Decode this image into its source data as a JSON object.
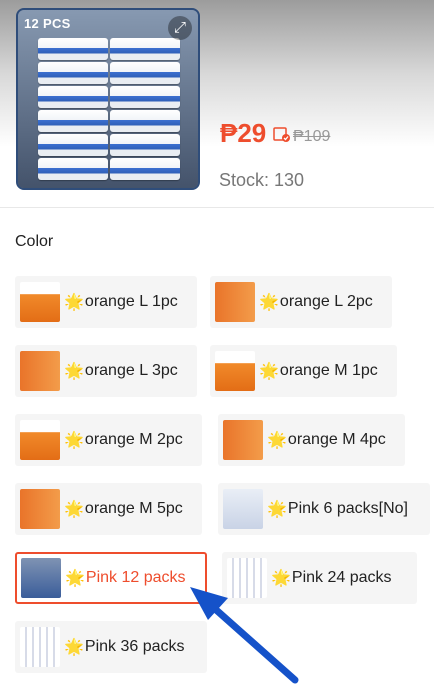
{
  "product": {
    "pcs_tag": "12 PCS",
    "price": "₱29",
    "original_price": "₱109",
    "stock_label": "Stock: 130"
  },
  "variations": {
    "label": "Color",
    "options": [
      {
        "label": "orange L 1pc",
        "selected": false
      },
      {
        "label": "orange L 2pc",
        "selected": false
      },
      {
        "label": "orange L 3pc",
        "selected": false
      },
      {
        "label": "orange M 1pc",
        "selected": false
      },
      {
        "label": "orange M 2pc",
        "selected": false
      },
      {
        "label": "orange M 4pc",
        "selected": false
      },
      {
        "label": "orange M 5pc",
        "selected": false
      },
      {
        "label": "Pink  6 packs[No]",
        "selected": false
      },
      {
        "label": "Pink  12 packs",
        "selected": true
      },
      {
        "label": "Pink  24 packs",
        "selected": false
      },
      {
        "label": "Pink  36 packs",
        "selected": false
      }
    ]
  },
  "colors": {
    "accent": "#ee4d2d",
    "arrow": "#1552c9"
  },
  "icons": {
    "expand": "expand-icon",
    "star": "star-icon",
    "voucher": "voucher-icon"
  }
}
